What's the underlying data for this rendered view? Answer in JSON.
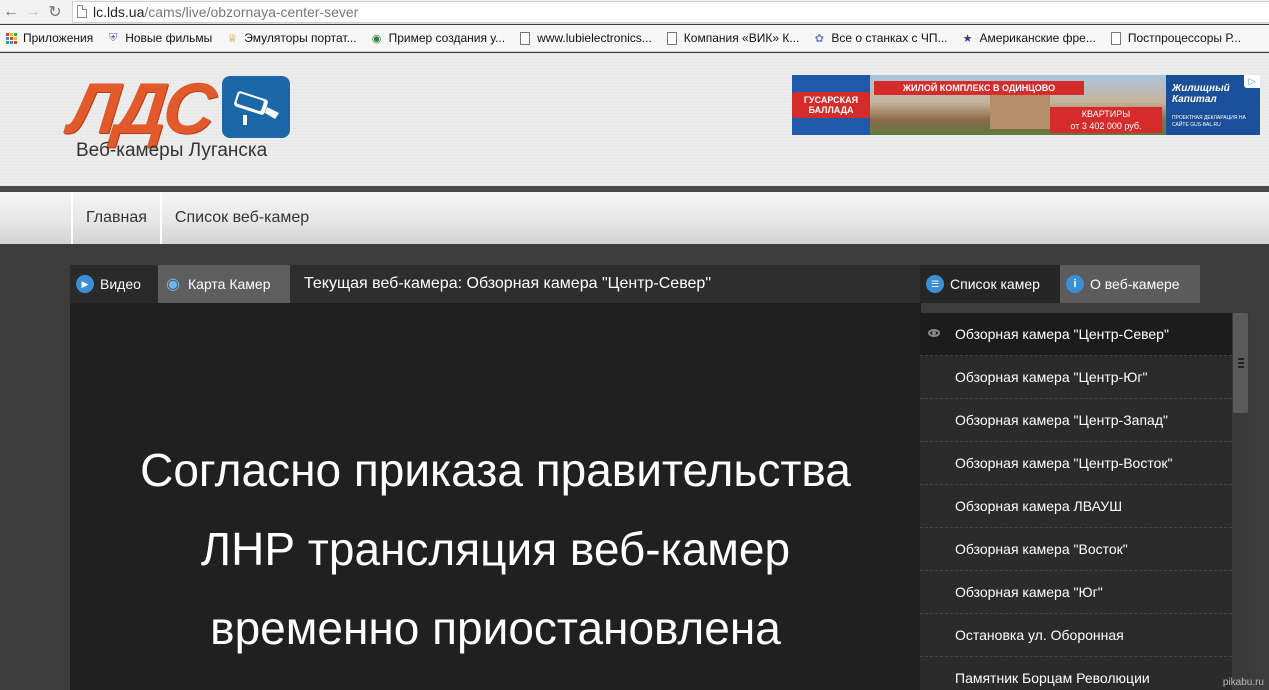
{
  "browser": {
    "url_host": "lc.lds.ua",
    "url_path": "/cams/live/obzornaya-center-sever",
    "bookmarks": [
      {
        "label": "Приложения",
        "icon": "apps-grid-icon"
      },
      {
        "label": "Новые фильмы",
        "icon": "shield-icon"
      },
      {
        "label": "Эмуляторы портат...",
        "icon": "crown-icon"
      },
      {
        "label": "Пример создания у...",
        "icon": "globe-icon"
      },
      {
        "label": "www.lubielectronics...",
        "icon": "document-icon"
      },
      {
        "label": "Компания «ВИК» К...",
        "icon": "document-icon"
      },
      {
        "label": "Все о станках с ЧП...",
        "icon": "gears-icon"
      },
      {
        "label": "Американские фре...",
        "icon": "star-icon"
      },
      {
        "label": "Постпроцессоры Р...",
        "icon": "document-icon"
      }
    ]
  },
  "site": {
    "logo_letters": "ЛДС",
    "logo_caption": "Веб-камеры Луганска"
  },
  "ad": {
    "left_badge": "ГУСАРСКАЯ БАЛЛАДА",
    "headline": "ЖИЛОЙ КОМПЛЕКС В ОДИНЦОВО",
    "price_line1": "КВАРТИРЫ",
    "price_line2": "от 3 402 000 руб.",
    "brand": "Жилищный Капитал",
    "fine_print": "ПРОЕКТНАЯ ДЕКЛАРАЦИЯ НА САЙТЕ GUS-BAL.RU"
  },
  "nav": {
    "home": "Главная",
    "camera_list": "Список веб-камер"
  },
  "tabs": {
    "video": "Видео",
    "map": "Карта Камер",
    "current_camera": "Текущая веб-камера: Обзорная камера \"Центр-Север\""
  },
  "notice": {
    "line1": "Согласно приказа правительства",
    "line2": "ЛНР трансляция веб-камер",
    "line3": "временно приостановлена"
  },
  "sidebar": {
    "list_tab": "Список камер",
    "about_tab": "О веб-камере",
    "cameras": [
      "Обзорная камера \"Центр-Север\"",
      "Обзорная камера \"Центр-Юг\"",
      "Обзорная камера \"Центр-Запад\"",
      "Обзорная камера \"Центр-Восток\"",
      "Обзорная камера ЛВАУШ",
      "Обзорная камера \"Восток\"",
      "Обзорная камера \"Юг\"",
      "Остановка ул. Оборонная",
      "Памятник Борцам Революции"
    ]
  },
  "watermark": "pikabu.ru",
  "colors": {
    "logo_orange": "#e2592c",
    "logo_blue": "#1a68a8",
    "content_bg": "#3c3c3c",
    "player_bg": "#202020"
  }
}
